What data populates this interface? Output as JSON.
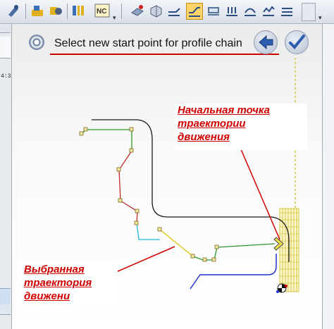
{
  "toolbar": {
    "buttons": [
      {
        "name": "chain-icon"
      },
      {
        "name": "machine-icon"
      },
      {
        "name": "tool-icon"
      },
      {
        "name": "stock-icon"
      },
      {
        "name": "nc-icon"
      },
      {
        "name": "views-icon"
      },
      {
        "name": "shaded-solid-icon"
      },
      {
        "name": "toolpath-view-icon"
      },
      {
        "name": "profile-view-active-icon"
      },
      {
        "name": "pocket-view-icon"
      },
      {
        "name": "drill-view-icon"
      },
      {
        "name": "contour-view-icon"
      },
      {
        "name": "surface-view-icon"
      },
      {
        "name": "more-view-icon"
      }
    ]
  },
  "left_strip": {
    "text": "4:3"
  },
  "prompt": {
    "text": "Select new start point for profile chain",
    "back_label": "Back",
    "ok_label": "OK"
  },
  "annotations": {
    "start_point": [
      "Начальная точка",
      "траектории",
      "движения"
    ],
    "selected_path": [
      "Выбранная",
      "траектория",
      "движени"
    ]
  },
  "colors": {
    "annotation": "#d10000",
    "chain_outline": "#1a1a1a",
    "green_segment": "#2b9a2b",
    "red_segment": "#c42a2a",
    "cyan_segment": "#27b8d8",
    "yellow_segment": "#e2cc2a",
    "blue_segment": "#2233cc",
    "stock_hatch": "#d5c63b"
  }
}
